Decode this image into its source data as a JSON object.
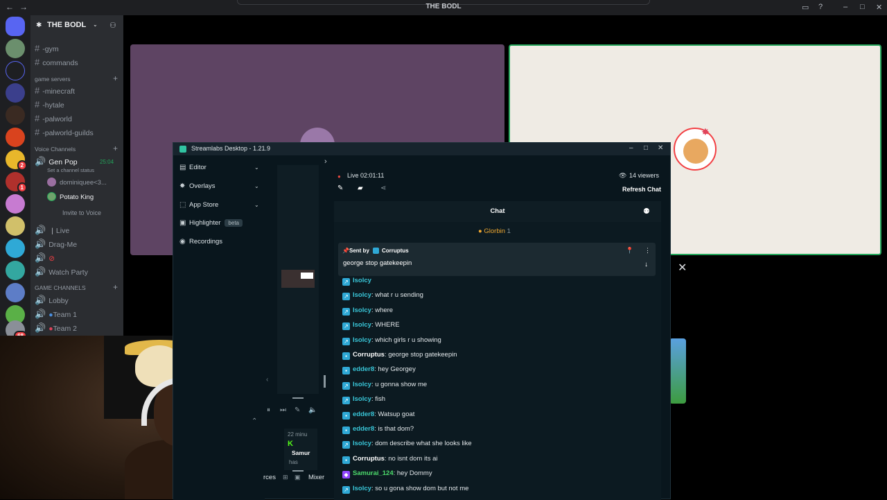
{
  "discord": {
    "window_title": "THE BODL",
    "server_name": "THE BODL",
    "channels": [
      {
        "name": "-gym",
        "icon": "hash"
      },
      {
        "name": "commands",
        "icon": "hash"
      }
    ],
    "cat_game_servers": "game servers",
    "game_channels": [
      "-minecraft",
      "-hytale",
      "-palworld",
      "-palworld-guilds"
    ],
    "cat_voice": "Voice Channels",
    "voice_channel": "Gen Pop",
    "voice_timer": "25:04",
    "voice_status": "Set a channel status",
    "voice_members": [
      "dominiquee<3...",
      "Potato King"
    ],
    "invite_label": "Invite to Voice",
    "live_channel": "Live",
    "other_voice": [
      "Drag-Me",
      "Watch Party"
    ],
    "cat_game_channels": "GAME CHANNELS",
    "game_voice": [
      "Lobby",
      "Team 1",
      "Team 2"
    ],
    "badges": [
      "2",
      "1",
      "68"
    ]
  },
  "streamlabs": {
    "title": "Streamlabs Desktop - 1.21.9",
    "nav": [
      {
        "label": "Editor",
        "icon": "▤",
        "chev": true
      },
      {
        "label": "Overlays",
        "icon": "✸",
        "chev": true
      },
      {
        "label": "App Store",
        "icon": "⬚",
        "chev": true
      },
      {
        "label": "Highlighter",
        "icon": "▣",
        "chev": false,
        "badge": "beta"
      },
      {
        "label": "Recordings",
        "icon": "◉",
        "chev": false
      }
    ],
    "live_label": "Live 02:01:11",
    "viewers": "14 viewers",
    "refresh": "Refresh Chat",
    "chat_title": "Chat",
    "glorbin": "Glorbin",
    "glorbin_count": "1",
    "pinned_by_label": "Sent by",
    "pinned_by": "Corruptus",
    "pinned_msg": "george stop gatekeepin",
    "mixer_label": "Mixer",
    "sources_label": "rces",
    "recent_time": "22 minu",
    "recent_user": "Samur",
    "recent_has": "has",
    "messages": [
      {
        "user": "Isolcy",
        "text": "",
        "badge": "prime",
        "color": "#39c6d8"
      },
      {
        "user": "Isolcy",
        "text": ": what r u sending",
        "badge": "prime",
        "color": "#39c6d8"
      },
      {
        "user": "Isolcy",
        "text": ": where",
        "badge": "prime",
        "color": "#39c6d8"
      },
      {
        "user": "Isolcy",
        "text": ": WHERE",
        "badge": "prime",
        "color": "#39c6d8"
      },
      {
        "user": "Isolcy",
        "text": ": which girls r u showing",
        "badge": "prime",
        "color": "#39c6d8"
      },
      {
        "user": "Corruptus",
        "text": ": george stop gatekeepin",
        "badge": "mod",
        "color": "#ffffff"
      },
      {
        "user": "edder8",
        "text": ": hey Georgey",
        "badge": "mod",
        "color": "#39c6d8"
      },
      {
        "user": "Isolcy",
        "text": ": u gonna show me",
        "badge": "prime",
        "color": "#39c6d8"
      },
      {
        "user": "Isolcy",
        "text": ": fish",
        "badge": "prime",
        "color": "#39c6d8"
      },
      {
        "user": "edder8",
        "text": ": Watsup goat",
        "badge": "mod",
        "color": "#39c6d8"
      },
      {
        "user": "edder8",
        "text": ": is that dom?",
        "badge": "mod",
        "color": "#39c6d8"
      },
      {
        "user": "Isolcy",
        "text": ": dom describe what she looks like",
        "badge": "prime",
        "color": "#39c6d8"
      },
      {
        "user": "Corruptus",
        "text": ": no isnt dom its ai",
        "badge": "mod",
        "color": "#ffffff"
      },
      {
        "user": "Samurai_124",
        "text": ": hey Dommy",
        "badge": "sub",
        "color": "#4ddc6c"
      },
      {
        "user": "Isolcy",
        "text": ": so u gona show dom but not me",
        "badge": "prime",
        "color": "#39c6d8"
      }
    ]
  }
}
